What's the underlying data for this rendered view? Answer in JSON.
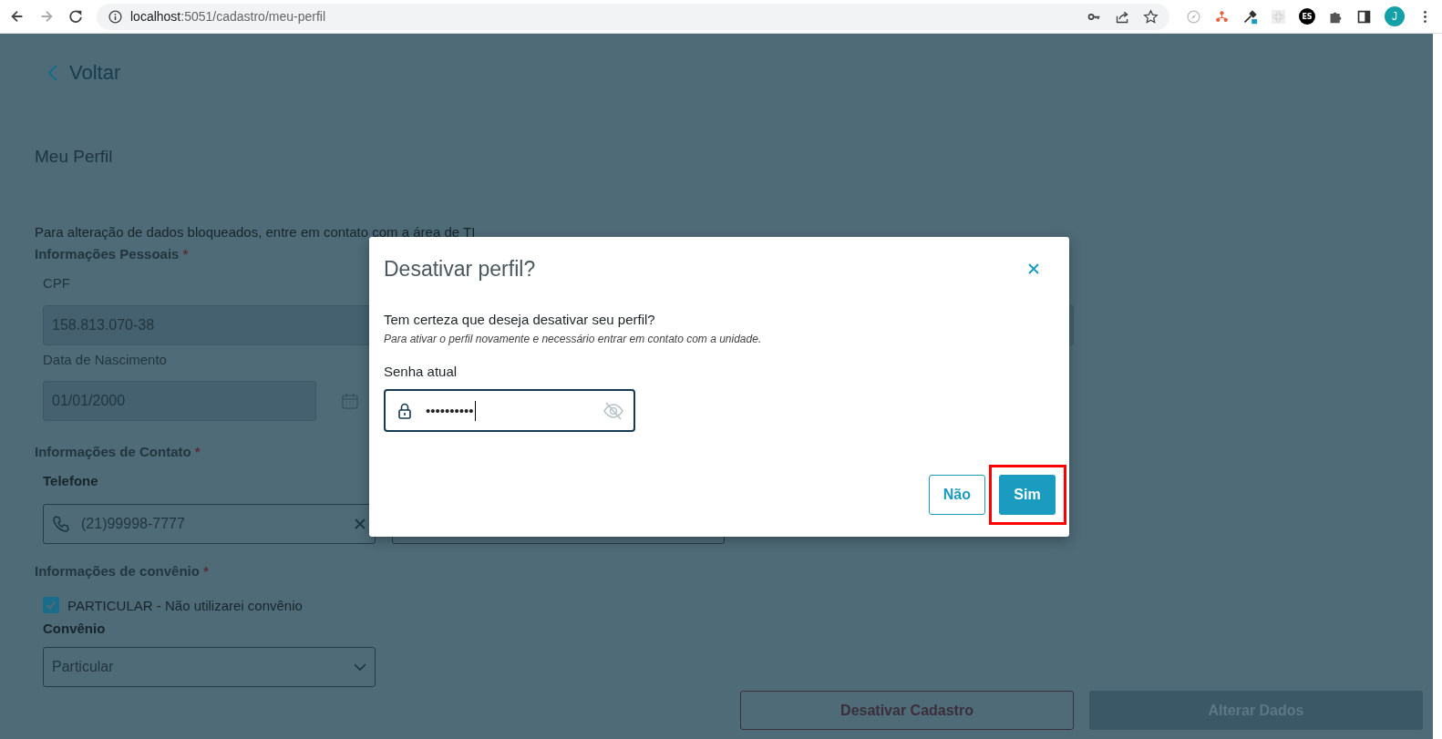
{
  "browser": {
    "url_host": "localhost",
    "url_path": ":5051/cadastro/meu-perfil",
    "forward_disabled": true,
    "extension_badge": "ES",
    "profile_initial": "J"
  },
  "page": {
    "back_link": "Voltar",
    "title": "Meu Perfil",
    "notice": "Para alteração de dados bloqueados, entre em contato com a área de TI",
    "personal": {
      "heading": "Informações Pessoais",
      "required_mark": "*",
      "cpf_label": "CPF",
      "cpf_value": "158.813.070-38",
      "birth_label": "Data de Nascimento",
      "birth_value": "01/01/2000"
    },
    "contact": {
      "heading": "Informações de Contato",
      "required_mark": "*",
      "phone_label": "Telefone",
      "phone_value": "(21)99998-7777"
    },
    "insurance": {
      "heading": "Informações de convênio",
      "required_mark": "*",
      "checkbox": {
        "label": "PARTICULAR - Não utilizarei convênio",
        "checked": true
      },
      "select_label": "Convênio",
      "select_value": "Particular"
    },
    "buttons": [
      {
        "label": "Desativar Cadastro",
        "disabled": false
      },
      {
        "label": "Alterar Dados",
        "disabled": true
      }
    ]
  },
  "modal": {
    "title": "Desativar perfil?",
    "question": "Tem certeza que deseja desativar seu perfil?",
    "note": "Para ativar o perfil novamente e necessário entrar em contato com a unidade.",
    "password_label": "Senha atual",
    "password_value": "••••••••••",
    "buttons": [
      {
        "label": "Não",
        "kind": "secondary",
        "highlighted": false
      },
      {
        "label": "Sim",
        "kind": "primary",
        "highlighted": true
      }
    ]
  }
}
